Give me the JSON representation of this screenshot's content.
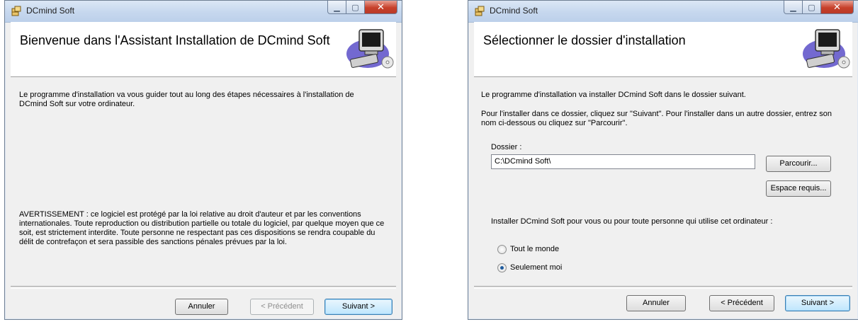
{
  "windows": [
    {
      "title": "DCmind Soft",
      "heading": "Bienvenue dans l'Assistant Installation de DCmind Soft",
      "intro_text": "Le programme d'installation va vous guider tout au long des étapes nécessaires à l'installation de DCmind Soft sur votre ordinateur.",
      "warning_text": "AVERTISSEMENT : ce logiciel est protégé par la loi relative au droit d'auteur et par les conventions internationales. Toute reproduction ou distribution partielle ou totale du logiciel, par quelque moyen que ce soit, est strictement interdite. Toute personne ne respectant pas ces dispositions se rendra coupable du délit de contrefaçon et sera passible des sanctions pénales prévues par la loi.",
      "buttons": {
        "cancel": "Annuler",
        "back": "< Précédent",
        "next": "Suivant >"
      }
    },
    {
      "title": "DCmind Soft",
      "heading": "Sélectionner le dossier d'installation",
      "intro_text": "Le programme d'installation va installer DCmind Soft dans le dossier suivant.",
      "instructions_text": "Pour l'installer dans ce dossier, cliquez sur \"Suivant\". Pour l'installer dans un autre dossier, entrez son nom ci-dessous ou cliquez sur \"Parcourir\".",
      "folder_label": "Dossier :",
      "folder_value": "C:\\DCmind Soft\\",
      "browse_button": "Parcourir...",
      "disk_cost_button": "Espace requis...",
      "install_for_label": "Installer DCmind Soft pour vous ou pour toute personne qui utilise cet ordinateur :",
      "options": [
        {
          "label": "Tout le monde",
          "selected": false
        },
        {
          "label": "Seulement moi",
          "selected": true
        }
      ],
      "buttons": {
        "cancel": "Annuler",
        "back": "< Précédent",
        "next": "Suivant >"
      }
    }
  ],
  "icons": {
    "app": "installer-package-icon",
    "banner": "computer-setup-icon"
  },
  "colors": {
    "titlebar": "#c6d7ee",
    "close_button": "#c7402a",
    "default_button": "#3c7fb1",
    "window_bg": "#f0f0f0"
  }
}
